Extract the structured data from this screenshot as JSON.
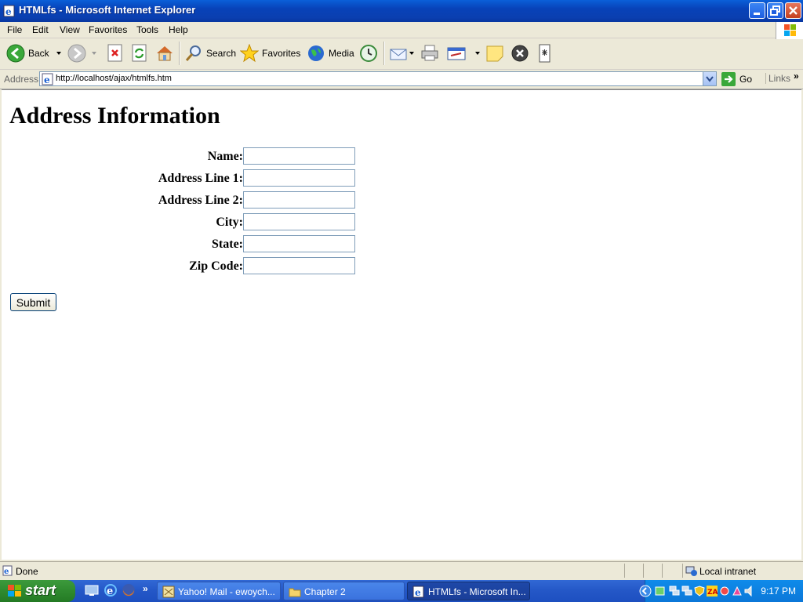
{
  "window": {
    "title": "HTMLfs - Microsoft Internet Explorer"
  },
  "menu": [
    "File",
    "Edit",
    "View",
    "Favorites",
    "Tools",
    "Help"
  ],
  "toolbar": {
    "back_label": "Back",
    "search_label": "Search",
    "favorites_label": "Favorites",
    "media_label": "Media"
  },
  "address": {
    "label": "Address",
    "url": "http://localhost/ajax/htmlfs.htm",
    "go_label": "Go",
    "links_label": "Links"
  },
  "page": {
    "heading": "Address Information",
    "fields": [
      {
        "label": "Name:",
        "value": ""
      },
      {
        "label": "Address Line 1:",
        "value": ""
      },
      {
        "label": "Address Line 2:",
        "value": ""
      },
      {
        "label": "City:",
        "value": ""
      },
      {
        "label": "State:",
        "value": ""
      },
      {
        "label": "Zip Code:",
        "value": ""
      }
    ],
    "submit_label": "Submit"
  },
  "status": {
    "text": "Done",
    "zone": "Local intranet"
  },
  "taskbar": {
    "start_label": "start",
    "tasks": [
      {
        "label": "Yahoo! Mail - ewoych..."
      },
      {
        "label": "Chapter 2"
      },
      {
        "label": "HTMLfs - Microsoft In..."
      }
    ],
    "clock": "9:17 PM"
  },
  "colors": {
    "titlebar": "#0a52d6",
    "taskbar": "#245edb",
    "start": "#2f8a2f",
    "tray": "#0f8bea"
  }
}
